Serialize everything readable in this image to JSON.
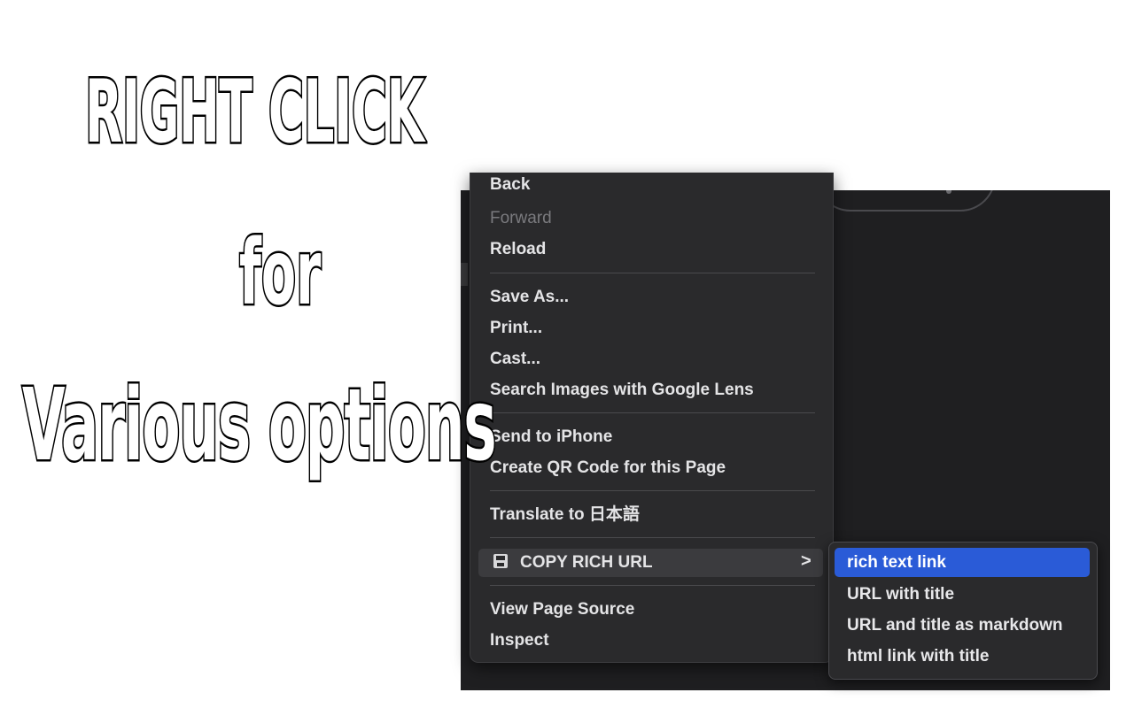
{
  "headline": {
    "line1": "RIGHT CLICK",
    "line2": "for",
    "line3": "Various options"
  },
  "context_menu": {
    "partial_top_item": "Back",
    "forward": "Forward",
    "reload": "Reload",
    "save_as": "Save As...",
    "print": "Print...",
    "cast": "Cast...",
    "search_images": "Search Images with Google Lens",
    "send_to_phone": "Send to iPhone",
    "qr_code": "Create QR Code for this Page",
    "translate": "Translate to 日本語",
    "copy_rich_url": "COPY RICH URL",
    "submenu_chevron": ">",
    "view_source": "View Page Source",
    "inspect": "Inspect"
  },
  "submenu": {
    "items": [
      "rich text link",
      "URL with title",
      "URL and title as markdown",
      "html link with title"
    ],
    "selected_index": 0
  },
  "colors": {
    "menu_bg": "#2a2a2c",
    "selection_blue": "#2a5bd7",
    "page_bg": "#ffffff"
  },
  "icons": {
    "extension_icon": "floppy-disk-icon",
    "submenu_arrow": "chevron-right-icon"
  }
}
